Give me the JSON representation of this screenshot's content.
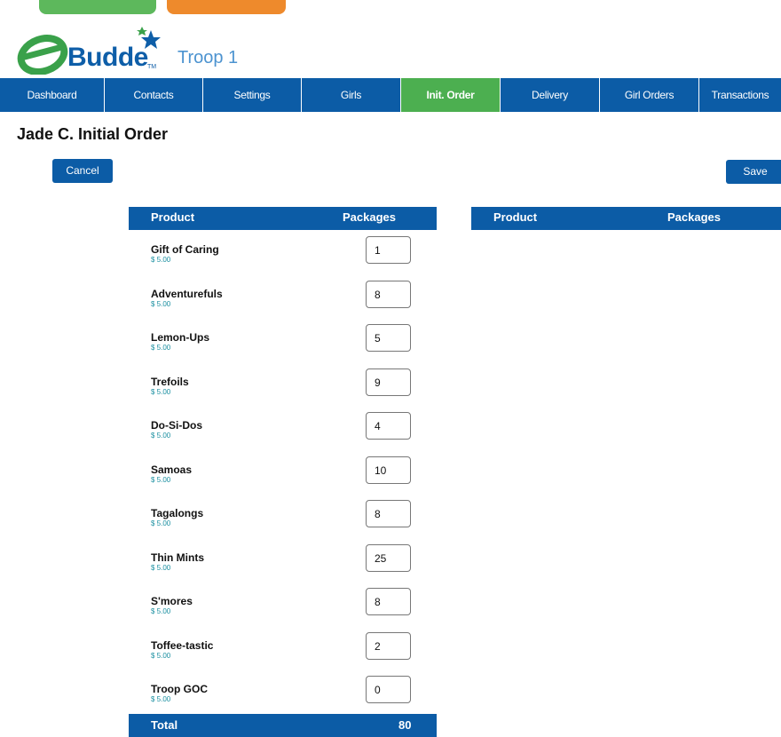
{
  "brand": {
    "logo_text": "Budde",
    "tm": "TM",
    "troop": "Troop 1"
  },
  "nav": {
    "items": [
      {
        "label": "Dashboard"
      },
      {
        "label": "Contacts"
      },
      {
        "label": "Settings"
      },
      {
        "label": "Girls"
      },
      {
        "label": "Init. Order",
        "active": true
      },
      {
        "label": "Delivery"
      },
      {
        "label": "Girl Orders"
      },
      {
        "label": "Transactions"
      }
    ]
  },
  "page": {
    "title": "Jade C. Initial Order"
  },
  "actions": {
    "cancel_label": "Cancel",
    "save_label": "Save"
  },
  "left_table": {
    "col_product": "Product",
    "col_packages": "Packages",
    "rows": [
      {
        "name": "Gift of Caring",
        "price": "$ 5.00",
        "qty": "1"
      },
      {
        "name": "Adventurefuls",
        "price": "$ 5.00",
        "qty": "8"
      },
      {
        "name": "Lemon-Ups",
        "price": "$ 5.00",
        "qty": "5"
      },
      {
        "name": "Trefoils",
        "price": "$ 5.00",
        "qty": "9"
      },
      {
        "name": "Do-Si-Dos",
        "price": "$ 5.00",
        "qty": "4"
      },
      {
        "name": "Samoas",
        "price": "$ 5.00",
        "qty": "10"
      },
      {
        "name": "Tagalongs",
        "price": "$ 5.00",
        "qty": "8"
      },
      {
        "name": "Thin Mints",
        "price": "$ 5.00",
        "qty": "25"
      },
      {
        "name": "S'mores",
        "price": "$ 5.00",
        "qty": "8"
      },
      {
        "name": "Toffee-tastic",
        "price": "$ 5.00",
        "qty": "2"
      },
      {
        "name": "Troop GOC",
        "price": "$ 5.00",
        "qty": "0"
      }
    ],
    "total_label": "Total",
    "total_value": "80"
  },
  "right_table": {
    "col_product": "Product",
    "col_packages": "Packages"
  },
  "colors": {
    "primary": "#0c5ca6",
    "active": "#4caf50",
    "price": "#1a8fa0",
    "pill_green": "#5db85c",
    "pill_orange": "#ee8a2c"
  }
}
